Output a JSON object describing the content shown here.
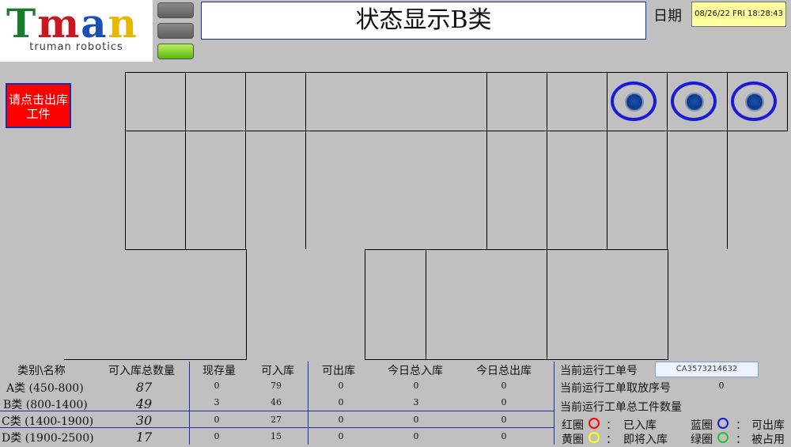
{
  "header": {
    "logo_text": "Tman",
    "logo_subtext": "truman robotics",
    "title": "状态显示B类",
    "date_label": "日期",
    "datetime": "08/26/22 FRI 18:28:43"
  },
  "indicators": {
    "colors": [
      "#7a7a7a",
      "#7a7a7a",
      "#7ed62a"
    ]
  },
  "release_button": {
    "label": "请点击出库工件"
  },
  "shelf": {
    "occupied_slot_color": "#1a1ad8",
    "occupied_slots": 3
  },
  "table": {
    "headers": [
      "类别\\名称",
      "可入库总数量",
      "现存量",
      "可入库",
      "可出库",
      "今日总入库",
      "今日总出库"
    ],
    "rows": [
      {
        "category": "A类 (450-800)",
        "capacity": "87",
        "stock": "0",
        "in_ok": "79",
        "out_ok": "0",
        "today_in": "0",
        "today_out": "0"
      },
      {
        "category": "B类 (800-1400)",
        "capacity": "49",
        "stock": "3",
        "in_ok": "46",
        "out_ok": "0",
        "today_in": "3",
        "today_out": "0"
      },
      {
        "category": "C类 (1400-1900)",
        "capacity": "30",
        "stock": "0",
        "in_ok": "27",
        "out_ok": "0",
        "today_in": "0",
        "today_out": "0"
      },
      {
        "category": "D类 (1900-2500)",
        "capacity": "17",
        "stock": "0",
        "in_ok": "15",
        "out_ok": "0",
        "today_in": "0",
        "today_out": "0"
      }
    ]
  },
  "workorder": {
    "id_label": "当前运行工单号",
    "id_value": "CA3573214632",
    "seq_label": "当前运行工单取放序号",
    "seq_value": "0",
    "total_label": "当前运行工单总工件数量"
  },
  "legend": [
    {
      "prefix": "红圈",
      "meaning": "已入库",
      "color": "#ff0000"
    },
    {
      "prefix": "蓝圈",
      "meaning": "可出库",
      "color": "#1a1ad8"
    },
    {
      "prefix": "黄圈",
      "meaning": "即将入库",
      "color": "#ffff00"
    },
    {
      "prefix": "绿圈",
      "meaning": "被占用",
      "color": "#22c322"
    }
  ],
  "legend_separator": "："
}
